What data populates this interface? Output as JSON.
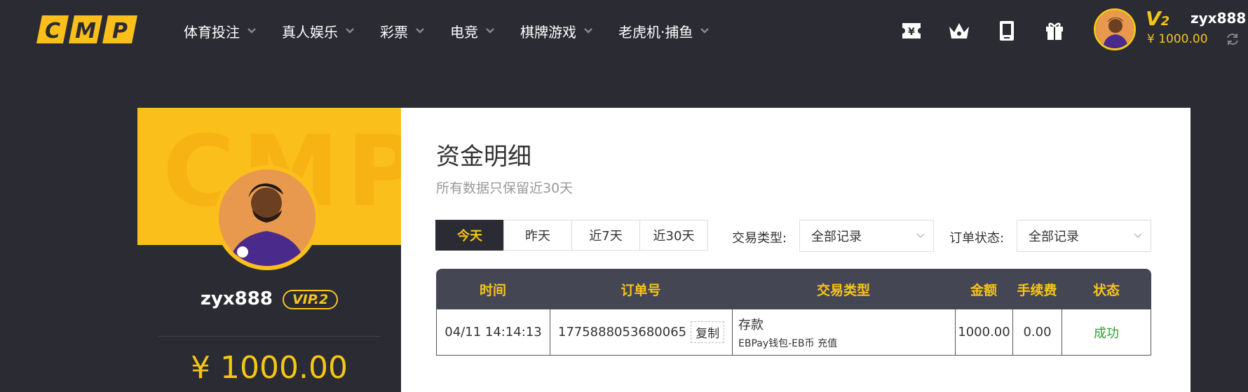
{
  "header": {
    "logo_text": "CMP",
    "nav": [
      {
        "label": "体育投注"
      },
      {
        "label": "真人娱乐"
      },
      {
        "label": "彩票"
      },
      {
        "label": "电竞"
      },
      {
        "label": "棋牌游戏"
      },
      {
        "label": "老虎机·捕鱼"
      }
    ],
    "icons": [
      "ticket-icon",
      "crown-icon",
      "tablet-icon",
      "gift-icon"
    ],
    "vip_letter": "V",
    "vip_level": "2",
    "username": "zyx888",
    "balance": "¥ 1000.00"
  },
  "profile": {
    "bg_text": "CMP",
    "username": "zyx888",
    "vip_badge": "VIP.2",
    "balance": "¥ 1000.00"
  },
  "main": {
    "title": "资金明细",
    "subtitle": "所有数据只保留近30天",
    "tabs": [
      {
        "label": "今天",
        "active": true
      },
      {
        "label": "昨天",
        "active": false
      },
      {
        "label": "近7天",
        "active": false
      },
      {
        "label": "近30天",
        "active": false
      }
    ],
    "filter_type_label": "交易类型:",
    "filter_type_value": "全部记录",
    "filter_status_label": "订单状态:",
    "filter_status_value": "全部记录"
  },
  "table": {
    "headers": [
      "时间",
      "订单号",
      "交易类型",
      "金额",
      "手续费",
      "状态"
    ],
    "rows": [
      {
        "time": "04/11 14:14:13",
        "order_no": "1775888053680065",
        "copy_label": "复制",
        "type_main": "存款",
        "type_sub": "EBPay钱包-EB币 充值",
        "amount": "1000.00",
        "fee": "0.00",
        "status": "成功"
      }
    ]
  },
  "colors": {
    "accent": "#f5c518",
    "dark": "#2a2b33",
    "table_header": "#454653",
    "success": "#2e9e2e"
  }
}
